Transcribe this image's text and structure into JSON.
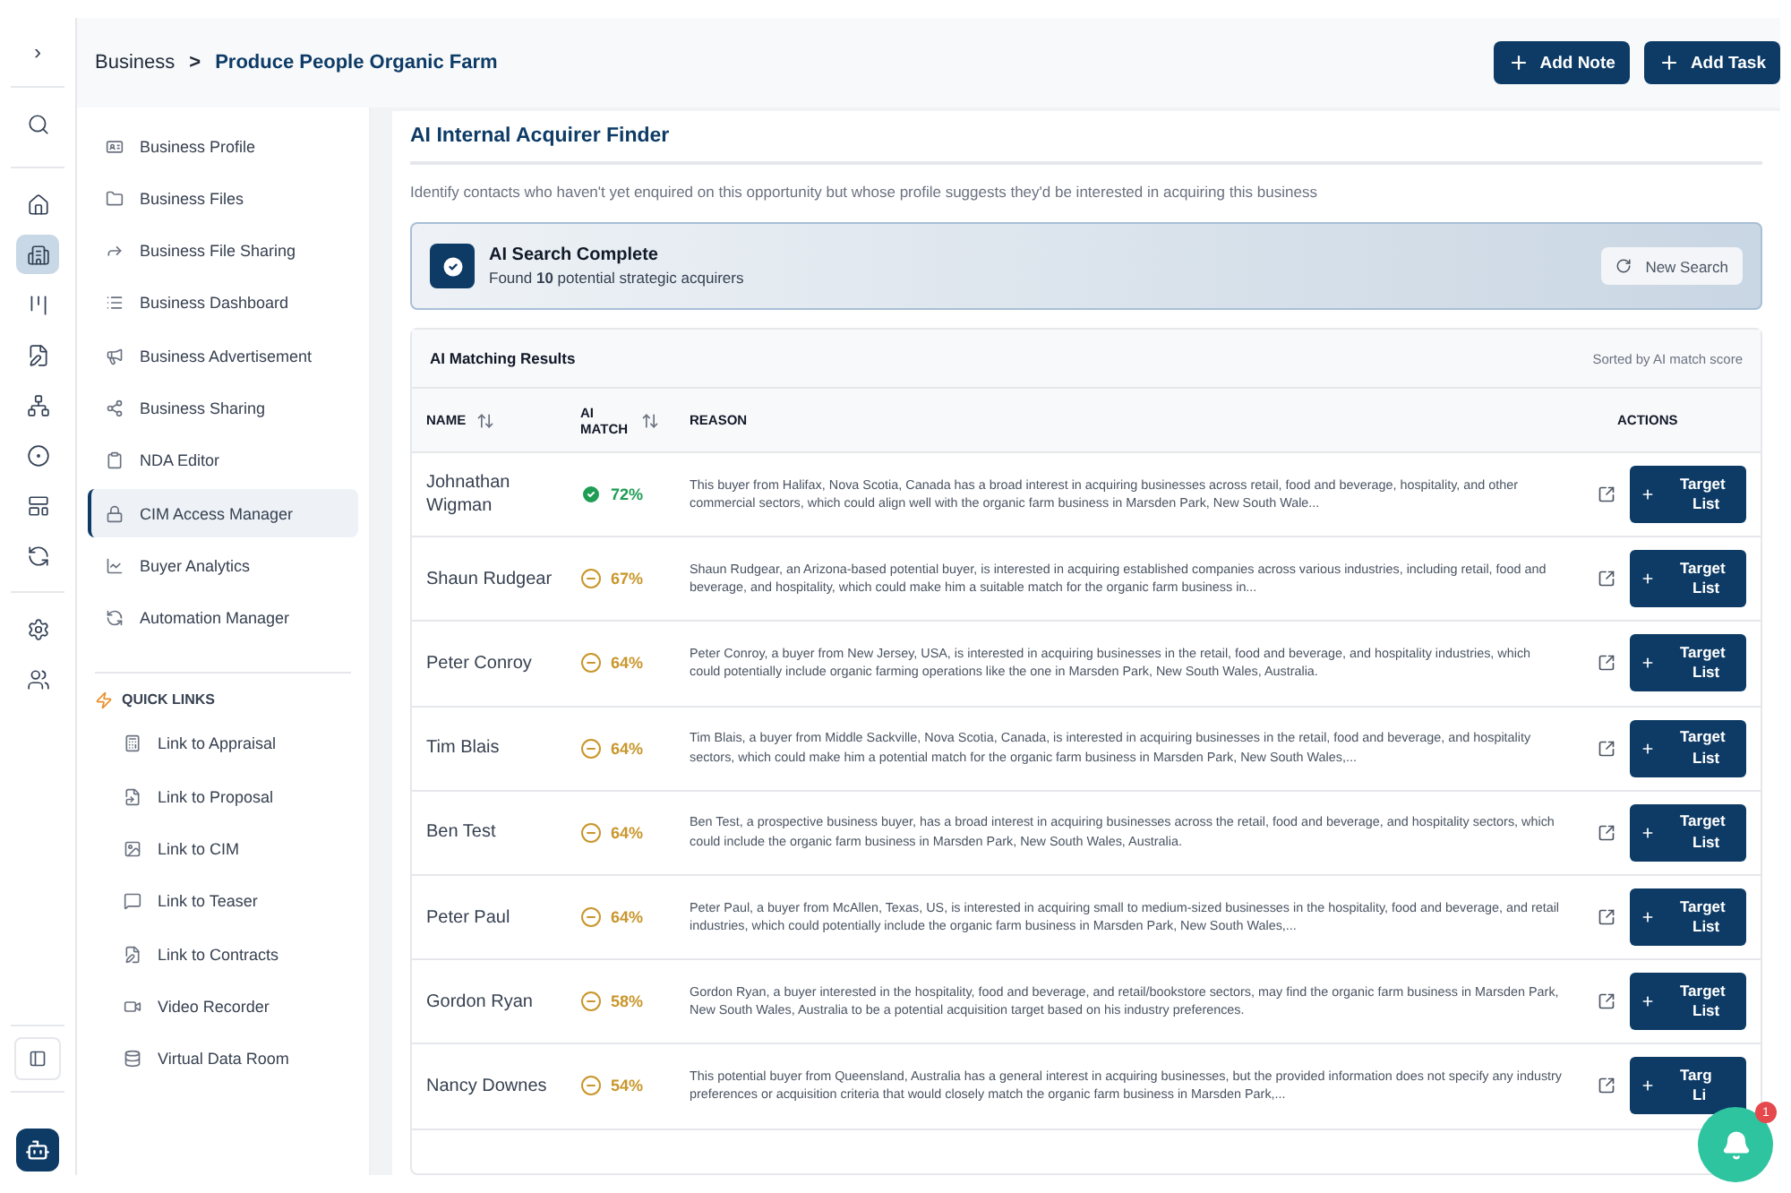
{
  "breadcrumb": {
    "parent": "Business",
    "separator": ">",
    "current": "Produce People Organic Farm"
  },
  "header_buttons": [
    {
      "label": "Add Note"
    },
    {
      "label": "Add Task"
    }
  ],
  "rail": {
    "toggle": "›",
    "items": [
      {
        "selected": false
      },
      {
        "selected": false
      },
      {
        "selected": true
      },
      {
        "selected": false
      },
      {
        "selected": false
      },
      {
        "selected": false
      },
      {
        "selected": false
      },
      {
        "selected": false
      },
      {
        "selected": false
      },
      {
        "selected": false
      },
      {
        "selected": false
      }
    ]
  },
  "nav": {
    "items": [
      {
        "label": "Business Profile",
        "selected": false
      },
      {
        "label": "Business Files",
        "selected": false
      },
      {
        "label": "Business File Sharing",
        "selected": false
      },
      {
        "label": "Business Dashboard",
        "selected": false
      },
      {
        "label": "Business Advertisement",
        "selected": false
      },
      {
        "label": "Business Sharing",
        "selected": false
      },
      {
        "label": "NDA Editor",
        "selected": false
      },
      {
        "label": "CIM Access Manager",
        "selected": true
      },
      {
        "label": "Buyer Analytics",
        "selected": false
      },
      {
        "label": "Automation Manager",
        "selected": false
      }
    ],
    "quick_links_title": "QUICK LINKS",
    "quick_links": [
      {
        "label": "Link to Appraisal"
      },
      {
        "label": "Link to Proposal"
      },
      {
        "label": "Link to CIM"
      },
      {
        "label": "Link to Teaser"
      },
      {
        "label": "Link to Contracts"
      },
      {
        "label": "Video Recorder"
      },
      {
        "label": "Virtual Data Room"
      }
    ]
  },
  "panel": {
    "title": "AI Internal Acquirer Finder",
    "description": "Identify contacts who haven't yet enquired on this opportunity but whose profile suggests they'd be interested in acquiring this business",
    "banner": {
      "title": "AI Search Complete",
      "subtitle": "Found **10** potential strategic acquirers",
      "button": "New Search"
    },
    "results": {
      "title": "AI Matching Results",
      "sort_note": "Sorted by AI match score",
      "columns": [
        {
          "label": "NAME",
          "sortable": true
        },
        {
          "label": "AI MATCH",
          "sortable": true
        },
        {
          "label": "REASON",
          "sortable": false
        },
        {
          "label": "ACTIONS",
          "sortable": false
        }
      ],
      "rows": [
        {
          "name": "Johnathan Wigman",
          "match": "72%",
          "kind": "strong",
          "reason": "This buyer from Halifax, Nova Scotia, Canada has a broad interest in acquiring businesses across retail, food and beverage, hospitality, and other commercial sectors, which could align well with the organic farm business in Marsden Park, New South Wale...",
          "button": [
            "Target",
            "List"
          ]
        },
        {
          "name": "Shaun Rudgear",
          "match": "67%",
          "kind": "moderate",
          "reason": "Shaun Rudgear, an Arizona-based potential buyer, is interested in acquiring established companies across various industries, including retail, food and beverage, and hospitality, which could make him a suitable match for the organic farm business in...",
          "button": [
            "Target",
            "List"
          ]
        },
        {
          "name": "Peter Conroy",
          "match": "64%",
          "kind": "moderate",
          "reason": "Peter Conroy, a buyer from New Jersey, USA, is interested in acquiring businesses in the retail, food and beverage, and hospitality industries, which could potentially include organic farming operations like the one in Marsden Park, New South Wales, Australia.",
          "button": [
            "Target",
            "List"
          ]
        },
        {
          "name": "Tim Blais",
          "match": "64%",
          "kind": "moderate",
          "reason": "Tim Blais, a buyer from Middle Sackville, Nova Scotia, Canada, is interested in acquiring businesses in the retail, food and beverage, and hospitality sectors, which could make him a potential match for the organic farm business in Marsden Park, New South Wales,...",
          "button": [
            "Target",
            "List"
          ]
        },
        {
          "name": "Ben Test",
          "match": "64%",
          "kind": "moderate",
          "reason": "Ben Test, a prospective business buyer, has a broad interest in acquiring businesses across the retail, food and beverage, and hospitality sectors, which could include the organic farm business in Marsden Park, New South Wales, Australia.",
          "button": [
            "Target",
            "List"
          ]
        },
        {
          "name": "Peter Paul",
          "match": "64%",
          "kind": "moderate",
          "reason": "Peter Paul, a buyer from McAllen, Texas, US, is interested in acquiring small to medium-sized businesses in the hospitality, food and beverage, and retail industries, which could potentially include the organic farm business in Marsden Park, New South Wales,...",
          "button": [
            "Target",
            "List"
          ]
        },
        {
          "name": "Gordon Ryan",
          "match": "58%",
          "kind": "moderate",
          "reason": "Gordon Ryan, a buyer interested in the hospitality, food and beverage, and retail/bookstore sectors, may find the organic farm business in Marsden Park, New South Wales, Australia to be a potential acquisition target based on his industry preferences.",
          "button": [
            "Target",
            "List"
          ]
        },
        {
          "name": "Nancy Downes",
          "match": "54%",
          "kind": "moderate",
          "reason": "This potential buyer from Queensland, Australia has a general interest in acquiring businesses, but the provided information does not specify any industry preferences or acquisition criteria that would closely match the organic farm business in Marsden Park,...",
          "button": [
            "Targ",
            "Li"
          ]
        }
      ]
    }
  },
  "notifications": {
    "count": "1"
  }
}
